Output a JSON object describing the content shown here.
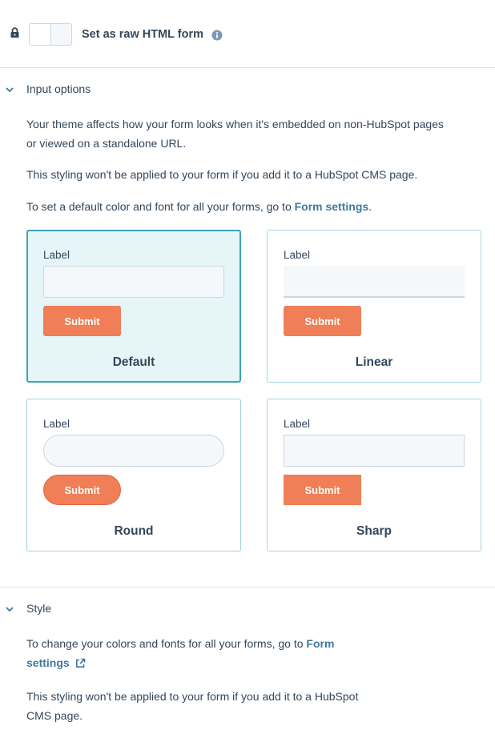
{
  "raw_html": {
    "label": "Set as raw HTML form",
    "toggle_on": false
  },
  "input_options": {
    "title": "Input options",
    "para1_line1": "Your theme affects how your form looks when it's embedded on non-HubSpot pages",
    "para1_line2": "or viewed on a standalone URL.",
    "para2": "This styling won't be applied to your form if you add it to a HubSpot CMS page.",
    "para3_prefix": "To set a default color and font for all your forms, go to ",
    "para3_link": "Form settings",
    "para3_suffix": ".",
    "themes": [
      {
        "name": "Default",
        "field_label": "Label",
        "button_label": "Submit",
        "selected": true
      },
      {
        "name": "Linear",
        "field_label": "Label",
        "button_label": "Submit",
        "selected": false
      },
      {
        "name": "Round",
        "field_label": "Label",
        "button_label": "Submit",
        "selected": false
      },
      {
        "name": "Sharp",
        "field_label": "Label",
        "button_label": "Submit",
        "selected": false
      }
    ]
  },
  "style": {
    "title": "Style",
    "para1_prefix": "To change your colors and fonts for all your forms, go to ",
    "para1_link_part1": "Form",
    "para1_link_part2": "settings",
    "para2_line1": "This styling won't be applied to your form if you add it to a HubSpot",
    "para2_line2": "CMS page."
  },
  "colors": {
    "accent": "#f07e56",
    "selected_border": "#3aa5b8",
    "selected_bg": "#e5f5f8",
    "link": "#4a7d9a",
    "text": "#33475b"
  },
  "icons": {
    "lock": "lock-icon",
    "info": "info-icon",
    "chevron": "chevron-down-icon",
    "external": "external-link-icon"
  }
}
